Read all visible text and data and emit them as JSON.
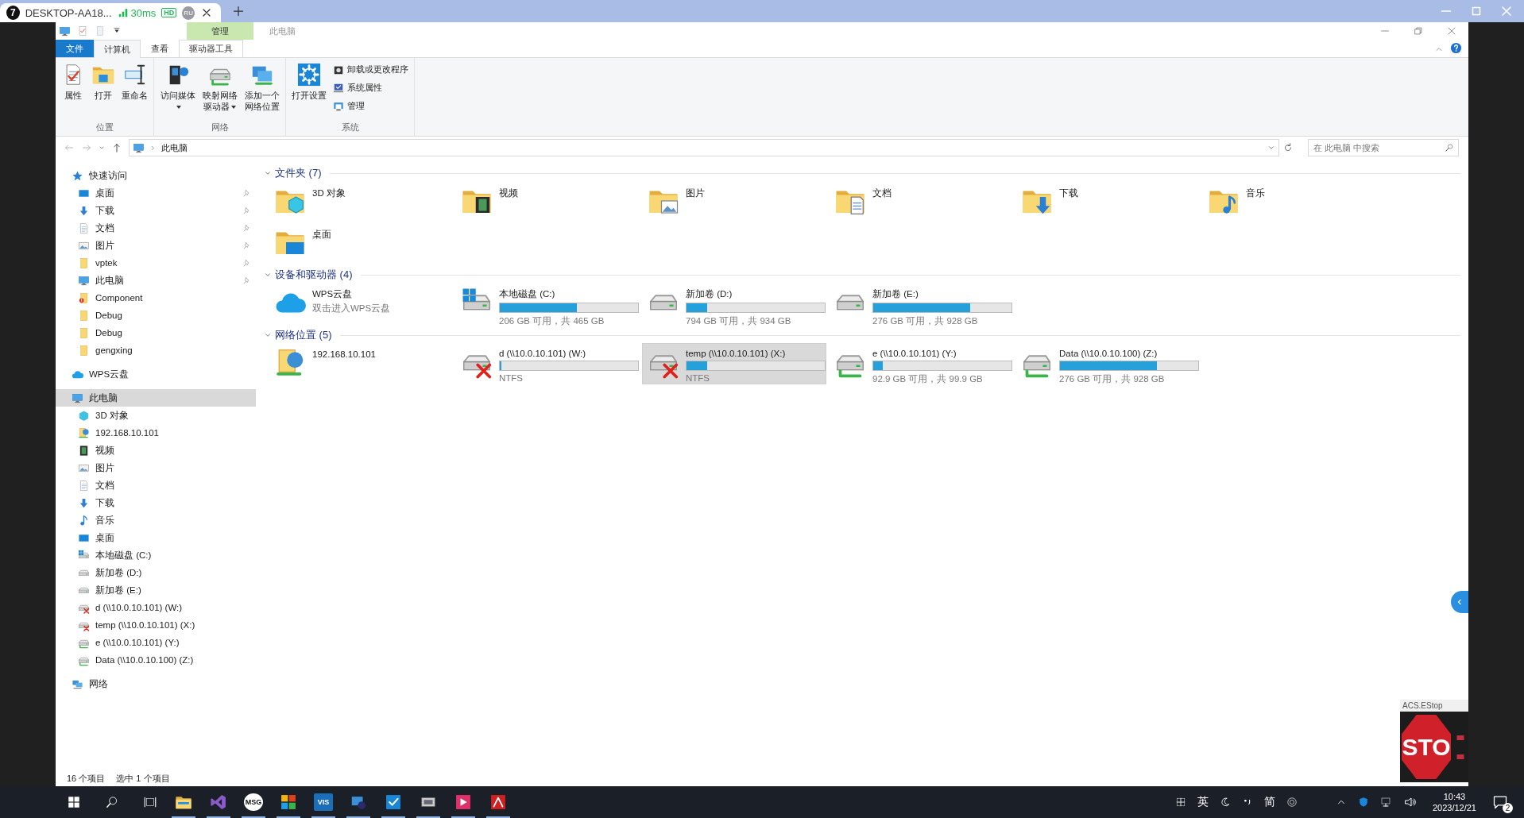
{
  "remote_tab": {
    "index": "7",
    "title": "DESKTOP-AA18...",
    "latency": "30ms",
    "quality": "HD",
    "user": "RU"
  },
  "window": {
    "context_tab": "管理",
    "title": "此电脑"
  },
  "ribbon": {
    "tabs": [
      {
        "label": "文件",
        "kind": "file",
        "selected": false
      },
      {
        "label": "计算机",
        "kind": "tab",
        "selected": true
      },
      {
        "label": "查看",
        "kind": "tab",
        "selected": false
      },
      {
        "label": "驱动器工具",
        "kind": "context",
        "selected": false
      }
    ],
    "groups": [
      {
        "name": "位置",
        "commands": [
          {
            "label": "属性",
            "kind": "large",
            "dropdown": false
          },
          {
            "label": "打开",
            "kind": "large",
            "dropdown": false
          },
          {
            "label": "重命名",
            "kind": "large",
            "dropdown": false
          }
        ]
      },
      {
        "name": "网络",
        "commands": [
          {
            "label": "访问媒体",
            "kind": "large",
            "dropdown": true
          },
          {
            "label": "映射网络驱动器",
            "kind": "large",
            "dropdown": true
          },
          {
            "label": "添加一个网络位置",
            "kind": "large",
            "dropdown": false
          }
        ]
      },
      {
        "name": "系统",
        "commands": [
          {
            "label": "打开设置",
            "kind": "large",
            "dropdown": false
          },
          {
            "label": "卸载或更改程序",
            "kind": "small",
            "dropdown": false
          },
          {
            "label": "系统属性",
            "kind": "small",
            "dropdown": false
          },
          {
            "label": "管理",
            "kind": "small",
            "dropdown": false
          }
        ]
      }
    ]
  },
  "address": {
    "path": "此电脑",
    "search_placeholder": "在 此电脑 中搜索"
  },
  "sidebar": [
    {
      "label": "快速访问",
      "selected": false,
      "children": [
        {
          "label": "桌面",
          "pinned": true,
          "selected": false
        },
        {
          "label": "下载",
          "pinned": true,
          "selected": false
        },
        {
          "label": "文档",
          "pinned": true,
          "selected": false
        },
        {
          "label": "图片",
          "pinned": true,
          "selected": false
        },
        {
          "label": "vptek",
          "pinned": true,
          "selected": false
        },
        {
          "label": "此电脑",
          "pinned": true,
          "selected": false
        },
        {
          "label": "Component",
          "pinned": false,
          "selected": false
        },
        {
          "label": "Debug",
          "pinned": false,
          "selected": false
        },
        {
          "label": "Debug",
          "pinned": false,
          "selected": false
        },
        {
          "label": "gengxing",
          "pinned": false,
          "selected": false
        }
      ]
    },
    {
      "label": "WPS云盘",
      "selected": false
    },
    {
      "label": "此电脑",
      "selected": true,
      "children": [
        {
          "label": "3D 对象",
          "pinned": false,
          "selected": false
        },
        {
          "label": "192.168.10.101",
          "pinned": false,
          "selected": false
        },
        {
          "label": "视频",
          "pinned": false,
          "selected": false
        },
        {
          "label": "图片",
          "pinned": false,
          "selected": false
        },
        {
          "label": "文档",
          "pinned": false,
          "selected": false
        },
        {
          "label": "下载",
          "pinned": false,
          "selected": false
        },
        {
          "label": "音乐",
          "pinned": false,
          "selected": false
        },
        {
          "label": "桌面",
          "pinned": false,
          "selected": false
        },
        {
          "label": "本地磁盘 (C:)",
          "pinned": false,
          "selected": false
        },
        {
          "label": "新加卷 (D:)",
          "pinned": false,
          "selected": false
        },
        {
          "label": "新加卷 (E:)",
          "pinned": false,
          "selected": false
        },
        {
          "label": "d (\\\\10.0.10.101) (W:)",
          "pinned": false,
          "selected": false
        },
        {
          "label": "temp (\\\\10.0.10.101) (X:)",
          "pinned": false,
          "selected": false
        },
        {
          "label": "e (\\\\10.0.10.101) (Y:)",
          "pinned": false,
          "selected": false
        },
        {
          "label": "Data (\\\\10.0.10.100) (Z:)",
          "pinned": false,
          "selected": false
        }
      ]
    },
    {
      "label": "网络",
      "selected": false
    }
  ],
  "groups": [
    {
      "title": "文件夹 (7)",
      "expanded": true,
      "items": [
        {
          "kind": "folder",
          "name": "3D 对象",
          "selected": false
        },
        {
          "kind": "folder",
          "name": "视频",
          "selected": false
        },
        {
          "kind": "folder",
          "name": "图片",
          "selected": false
        },
        {
          "kind": "folder",
          "name": "文档",
          "selected": false
        },
        {
          "kind": "folder",
          "name": "下载",
          "selected": false
        },
        {
          "kind": "folder",
          "name": "音乐",
          "selected": false
        },
        {
          "kind": "folder",
          "name": "桌面",
          "selected": false
        }
      ]
    },
    {
      "title": "设备和驱动器 (4)",
      "expanded": true,
      "items": [
        {
          "kind": "cloud",
          "name": "WPS云盘",
          "caption": "双击进入WPS云盘",
          "selected": false
        },
        {
          "kind": "drive",
          "name": "本地磁盘 (C:)",
          "system": true,
          "level": 0.56,
          "caption": "206 GB 可用，共 465 GB",
          "selected": false
        },
        {
          "kind": "drive",
          "name": "新加卷 (D:)",
          "system": false,
          "level": 0.15,
          "caption": "794 GB 可用，共 934 GB",
          "selected": false
        },
        {
          "kind": "drive",
          "name": "新加卷 (E:)",
          "system": false,
          "level": 0.7,
          "caption": "276 GB 可用，共 928 GB",
          "selected": false
        }
      ]
    },
    {
      "title": "网络位置 (5)",
      "expanded": true,
      "items": [
        {
          "kind": "location",
          "name": "192.168.10.101",
          "selected": false
        },
        {
          "kind": "network-drive",
          "name": "d (\\\\10.0.10.101) (W:)",
          "connected": false,
          "level": 0.01,
          "caption": "NTFS",
          "selected": false
        },
        {
          "kind": "network-drive",
          "name": "temp (\\\\10.0.10.101) (X:)",
          "connected": false,
          "level": 0.15,
          "caption": "NTFS",
          "selected": true
        },
        {
          "kind": "network-drive",
          "name": "e (\\\\10.0.10.101) (Y:)",
          "connected": true,
          "level": 0.07,
          "caption": "92.9 GB 可用，共 99.9 GB",
          "selected": false
        },
        {
          "kind": "network-drive",
          "name": "Data (\\\\10.0.10.100) (Z:)",
          "connected": true,
          "level": 0.7,
          "caption": "276 GB 可用，共 928 GB",
          "selected": false
        }
      ]
    }
  ],
  "status_bar": {
    "item_count": "16 个项目",
    "selection": "选中 1 个项目"
  },
  "estop": {
    "title": "ACS.EStop",
    "sign": "STO"
  },
  "taskbar": {
    "apps": [
      {
        "running": true
      },
      {
        "running": true
      },
      {
        "label": "MSG",
        "running": true
      },
      {
        "running": true
      },
      {
        "label": "VIS",
        "running": true
      },
      {
        "running": true
      },
      {
        "running": true
      },
      {
        "running": true
      },
      {
        "running": true
      },
      {
        "running": true
      }
    ],
    "ime": [
      "英",
      "简"
    ],
    "time": "10:43",
    "date": "2023/12/21",
    "notifications": "2"
  }
}
